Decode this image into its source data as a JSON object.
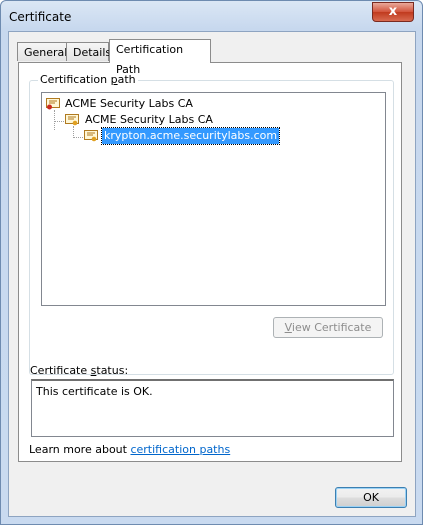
{
  "window": {
    "title": "Certificate",
    "close_label": "x"
  },
  "tabs": [
    {
      "label": "General",
      "active": false
    },
    {
      "label": "Details",
      "active": false
    },
    {
      "label": "Certification Path",
      "active": true
    }
  ],
  "certification_path": {
    "group_label_pre": "Certification ",
    "group_label_accel": "p",
    "group_label_post": "ath",
    "items": [
      {
        "label": "ACME Security Labs CA",
        "level": 0,
        "icon": "certificate-root-icon"
      },
      {
        "label": "ACME Security Labs CA",
        "level": 1,
        "icon": "certificate-icon"
      },
      {
        "label": "krypton.acme.securitylabs.com",
        "level": 2,
        "icon": "certificate-icon",
        "selected": true
      }
    ],
    "view_button": {
      "accel": "V",
      "rest": "iew Certificate",
      "disabled": true
    }
  },
  "status": {
    "label_pre": "Certificate ",
    "label_accel": "s",
    "label_post": "tatus:",
    "text": "This certificate is OK."
  },
  "learn_more": {
    "text": "Learn more about ",
    "link": "certification paths"
  },
  "ok_button": {
    "label": "OK"
  },
  "colors": {
    "selection": "#3399ff",
    "link": "#0066cc",
    "close_red": "#c03a1e"
  }
}
